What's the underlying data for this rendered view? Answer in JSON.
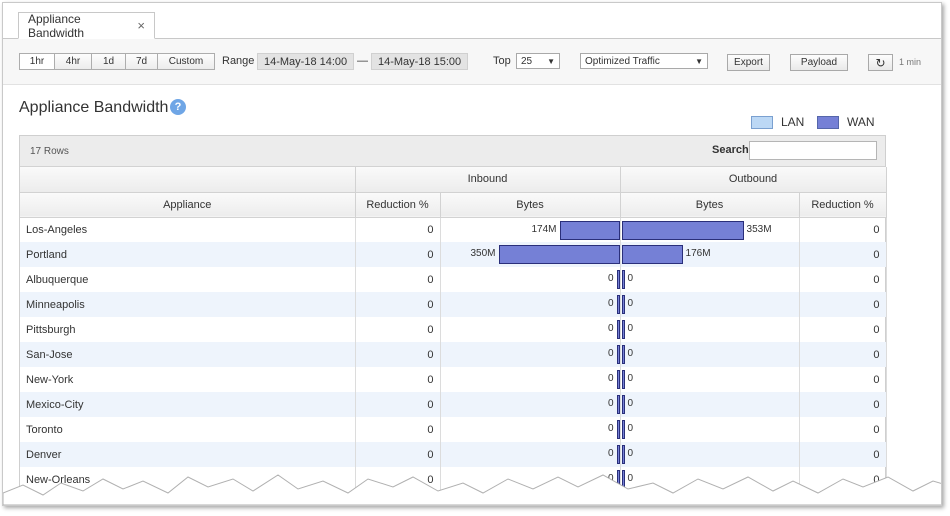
{
  "tab": {
    "label": "Appliance Bandwidth",
    "close": "×"
  },
  "toolbar": {
    "time_buttons": [
      "1hr",
      "4hr",
      "1d",
      "7d",
      "Custom"
    ],
    "range_label": "Range",
    "range_start": "14-May-18 14:00",
    "range_sep": "—",
    "range_end": "14-May-18 15:00",
    "top_label": "Top",
    "top_value": "25",
    "traffic_value": "Optimized Traffic",
    "export_label": "Export",
    "payload_label": "Payload",
    "refresh_icon": "↻",
    "refresh_interval": "1 min"
  },
  "page": {
    "title": "Appliance Bandwidth",
    "help": "?"
  },
  "legend": [
    {
      "label": "LAN",
      "color": "#bcd8f5"
    },
    {
      "label": "WAN",
      "color": "#7580d6"
    }
  ],
  "table": {
    "row_count": "17 Rows",
    "search_label": "Search",
    "group_inbound": "Inbound",
    "group_outbound": "Outbound",
    "col_appliance": "Appliance",
    "col_in_reduction": "Reduction %",
    "col_in_bytes": "Bytes",
    "col_out_bytes": "Bytes",
    "col_out_reduction": "Reduction %",
    "rows": [
      {
        "appliance": "Los-Angeles",
        "in_reduction": "0",
        "in_bytes": "174M",
        "out_bytes": "353M",
        "out_reduction": "0",
        "in_val": 174,
        "out_val": 353
      },
      {
        "appliance": "Portland",
        "in_reduction": "0",
        "in_bytes": "350M",
        "out_bytes": "176M",
        "out_reduction": "0",
        "in_val": 350,
        "out_val": 176
      },
      {
        "appliance": "Albuquerque",
        "in_reduction": "0",
        "in_bytes": "0",
        "out_bytes": "0",
        "out_reduction": "0",
        "in_val": 0,
        "out_val": 0
      },
      {
        "appliance": "Minneapolis",
        "in_reduction": "0",
        "in_bytes": "0",
        "out_bytes": "0",
        "out_reduction": "0",
        "in_val": 0,
        "out_val": 0
      },
      {
        "appliance": "Pittsburgh",
        "in_reduction": "0",
        "in_bytes": "0",
        "out_bytes": "0",
        "out_reduction": "0",
        "in_val": 0,
        "out_val": 0
      },
      {
        "appliance": "San-Jose",
        "in_reduction": "0",
        "in_bytes": "0",
        "out_bytes": "0",
        "out_reduction": "0",
        "in_val": 0,
        "out_val": 0
      },
      {
        "appliance": "New-York",
        "in_reduction": "0",
        "in_bytes": "0",
        "out_bytes": "0",
        "out_reduction": "0",
        "in_val": 0,
        "out_val": 0
      },
      {
        "appliance": "Mexico-City",
        "in_reduction": "0",
        "in_bytes": "0",
        "out_bytes": "0",
        "out_reduction": "0",
        "in_val": 0,
        "out_val": 0
      },
      {
        "appliance": "Toronto",
        "in_reduction": "0",
        "in_bytes": "0",
        "out_bytes": "0",
        "out_reduction": "0",
        "in_val": 0,
        "out_val": 0
      },
      {
        "appliance": "Denver",
        "in_reduction": "0",
        "in_bytes": "0",
        "out_bytes": "0",
        "out_reduction": "0",
        "in_val": 0,
        "out_val": 0
      },
      {
        "appliance": "New-Orleans",
        "in_reduction": "0",
        "in_bytes": "0",
        "out_bytes": "0",
        "out_reduction": "0",
        "in_val": 0,
        "out_val": 0
      }
    ]
  }
}
